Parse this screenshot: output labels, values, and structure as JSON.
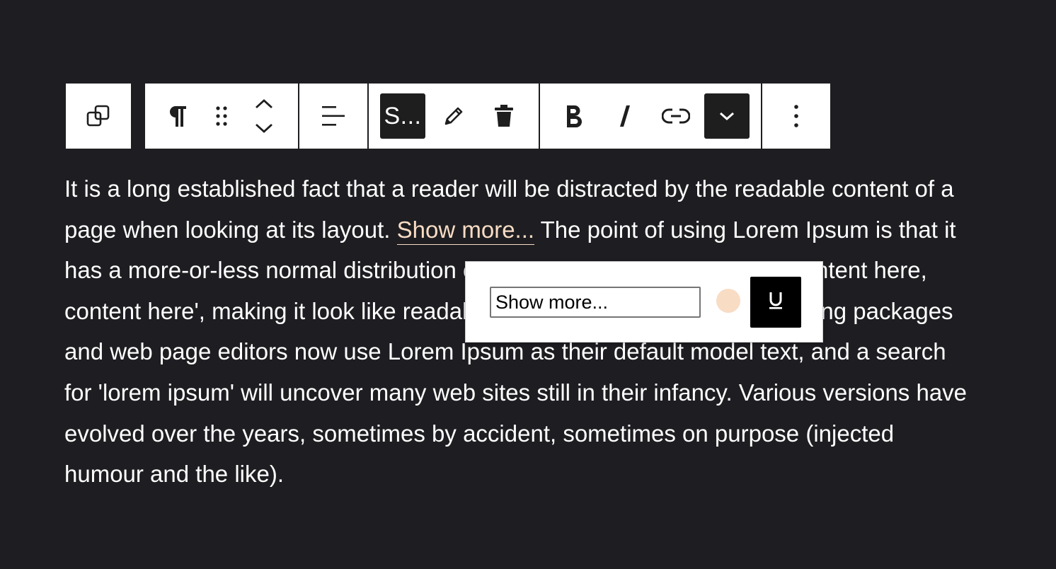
{
  "toolbar": {
    "style_button_label": "S...",
    "icons": {
      "transform": "duplicate-squares-icon",
      "paragraph": "pilcrow-icon",
      "drag": "drag-handle-icon",
      "move": "move-up-down-icon",
      "align": "align-left-icon",
      "edit": "pencil-icon",
      "delete": "trash-icon",
      "bold": "bold-icon",
      "italic": "italic-icon",
      "link": "link-icon",
      "more_formats": "chevron-down-icon",
      "options": "vertical-ellipsis-icon"
    }
  },
  "content": {
    "before_link": "It is a long established fact that a reader will be distracted by the readable content of a page when looking at its layout. ",
    "link_text": "Show more...",
    "after_link": " The point of using Lorem Ipsum is that it has a more-or-less normal distribution of letters, as opposed to using 'Content here, content here', making it look like readable English. Many desktop publishing packages and web page editors now use Lorem Ipsum as their default model text, and a search for 'lorem ipsum' will uncover many web sites still in their infancy. Various versions have evolved over the years, sometimes by accident, sometimes on purpose (injected humour and the like)."
  },
  "popover": {
    "input_value": "Show more...",
    "swatch_color": "#f8dcc4",
    "underline_label": "U"
  },
  "colors": {
    "background": "#1e1e22",
    "link": "#f8dcc4",
    "active_button": "#1e1e1e"
  }
}
